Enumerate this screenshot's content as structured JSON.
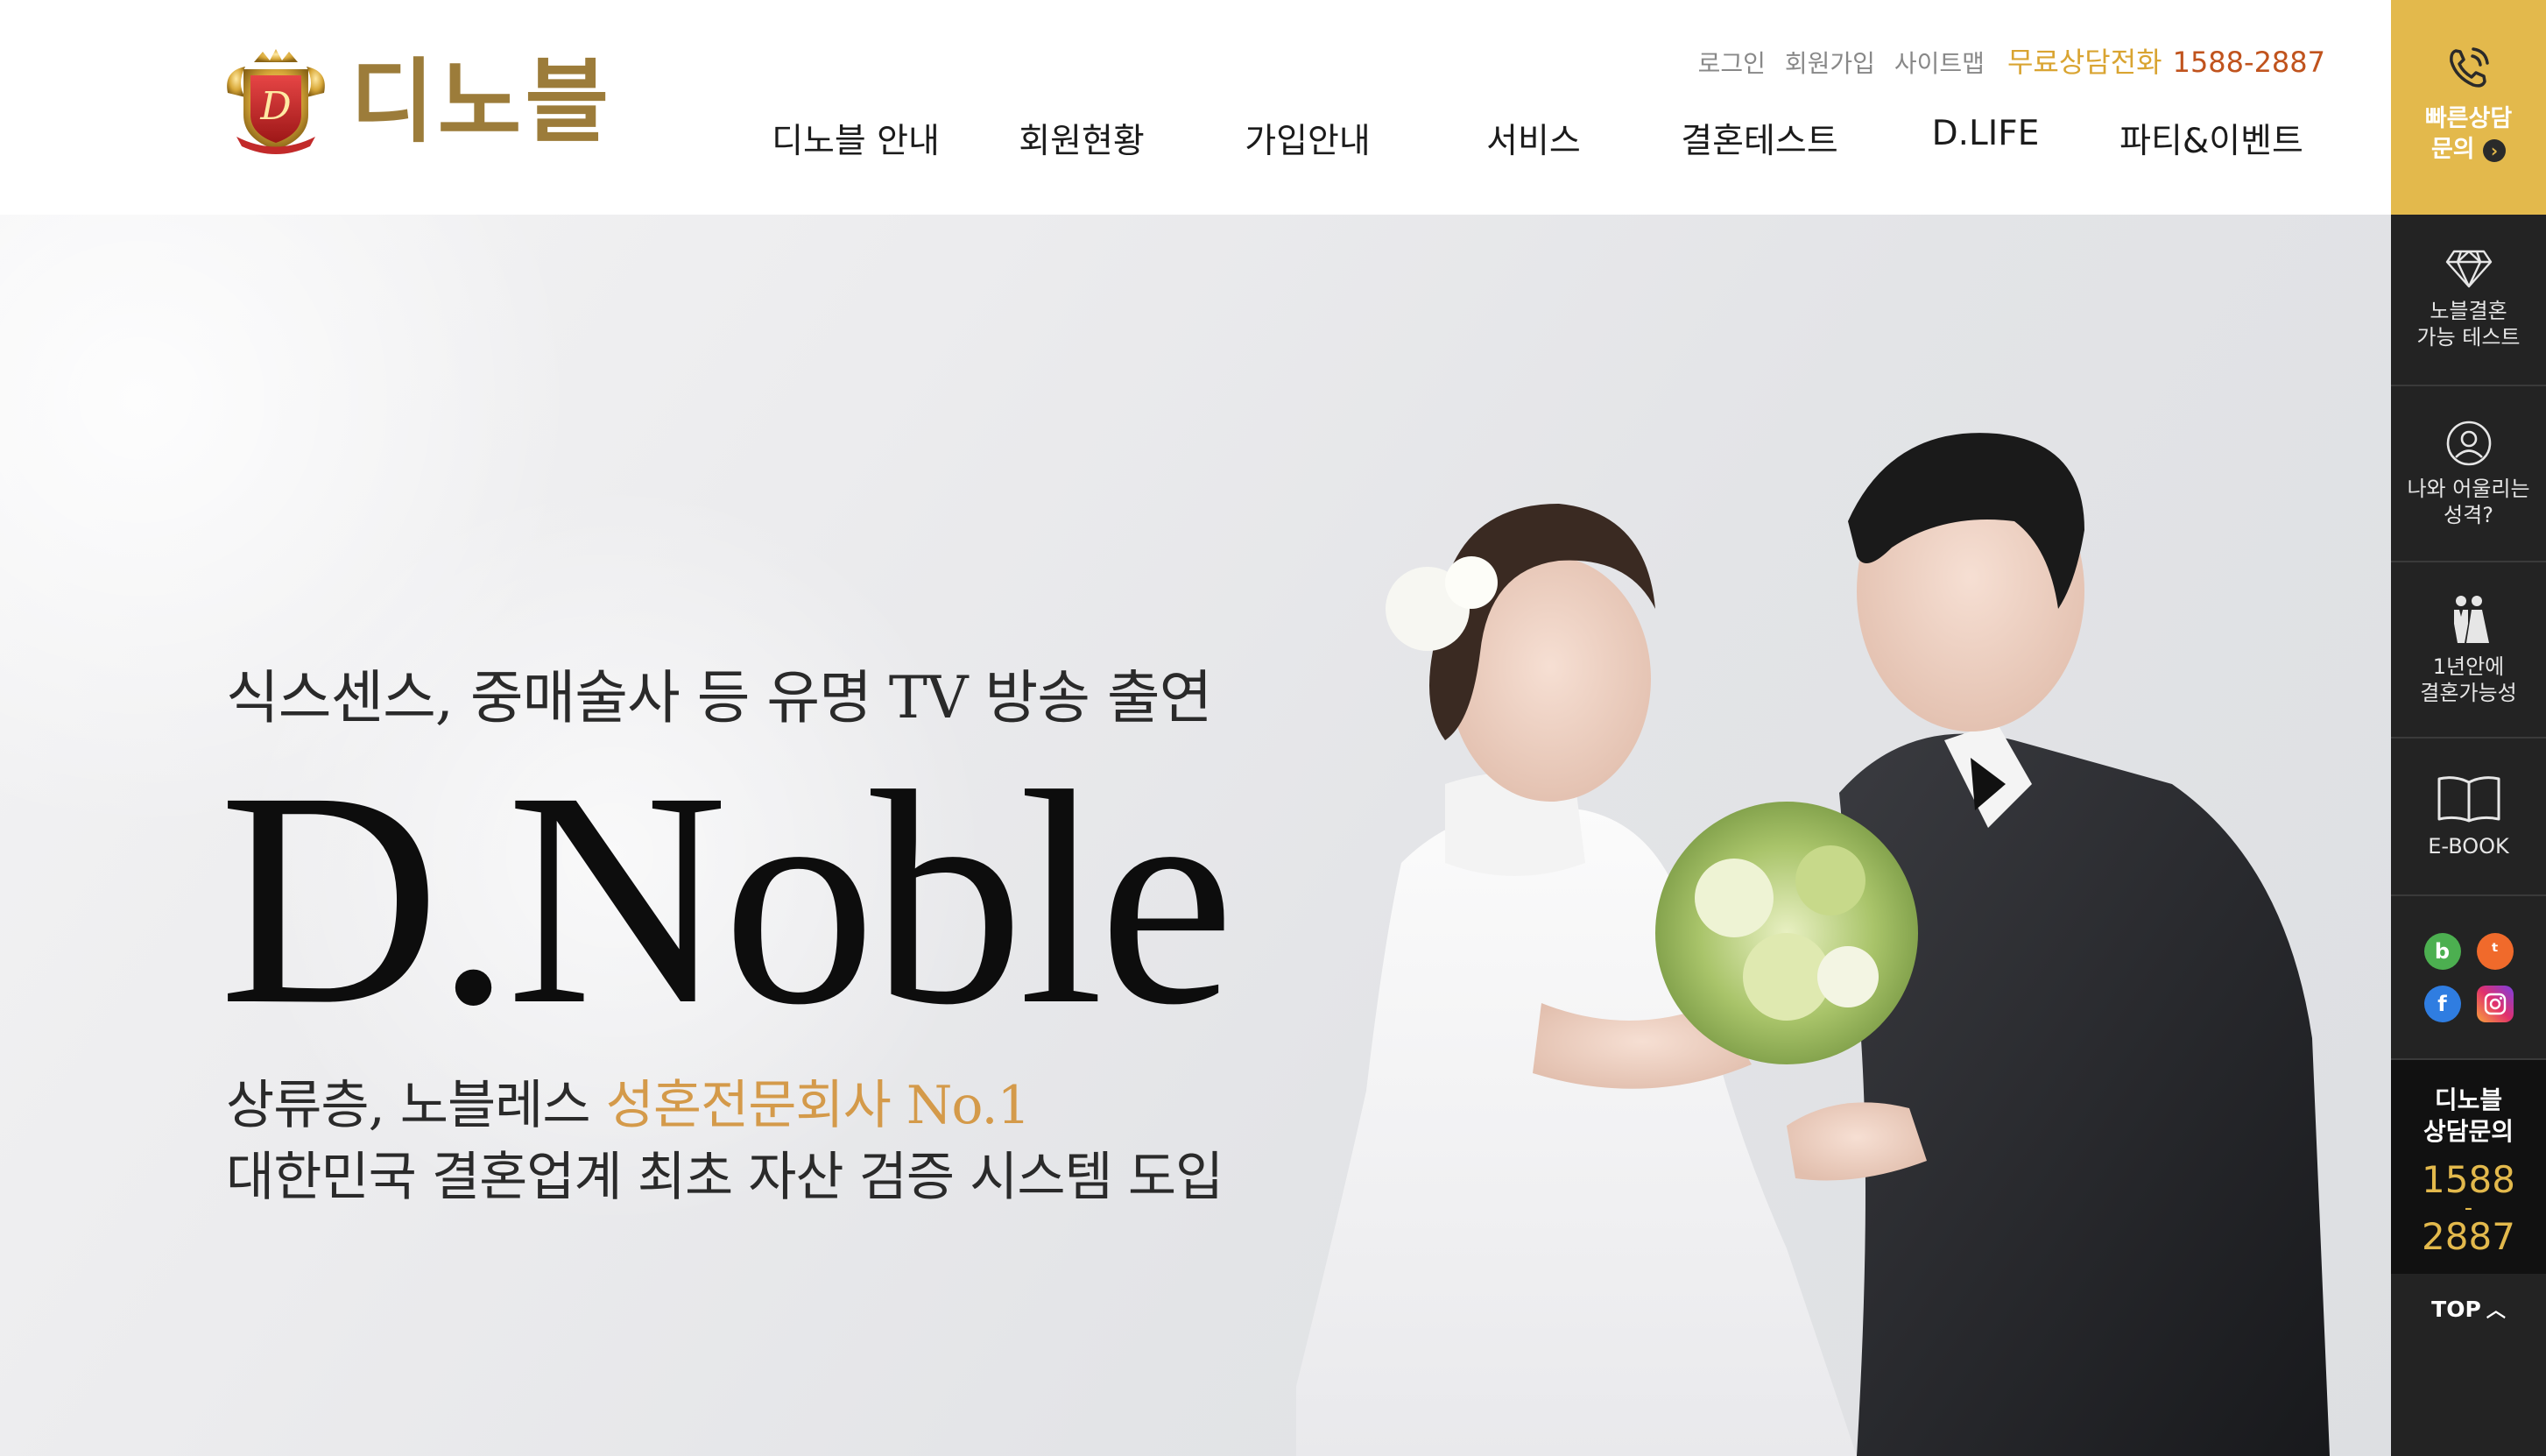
{
  "header": {
    "logo_text": "디노블",
    "util": {
      "login": "로그인",
      "join": "회원가입",
      "sitemap": "사이트맵",
      "phone_label": "무료상담전화",
      "phone_number": "1588-2887"
    },
    "nav": [
      "디노블 안내",
      "회원현황",
      "가입안내",
      "서비스",
      "결혼테스트",
      "D.LIFE",
      "파티&이벤트"
    ]
  },
  "hero": {
    "subtitle": "식스센스, 중매술사 등 유명 TV 방송 출연",
    "title": "D.Noble",
    "line1_prefix": "상류층, 노블레스 ",
    "line1_accent": "성혼전문회사 No.1",
    "line2": "대한민국 결혼업계 최초 자산 검증 시스템 도입"
  },
  "quick": {
    "consult": [
      "빠른상담",
      "문의"
    ],
    "test": [
      "노블결혼",
      "가능 테스트"
    ],
    "personality": [
      "나와 어울리는",
      "성격?"
    ],
    "marriage": [
      "1년안에",
      "결혼가능성"
    ],
    "ebook": [
      "E-BOOK"
    ],
    "call_title": [
      "디노블",
      "상담문의"
    ],
    "call_number": [
      "1588",
      "-",
      "2887"
    ],
    "top": "TOP",
    "sns": [
      "blog-icon",
      "kakao-story-icon",
      "facebook-icon",
      "instagram-icon"
    ]
  },
  "colors": {
    "accent_gold": "#e3b94c",
    "phone_orange": "#c0531d",
    "hero_accent": "#d49a4a",
    "sidebar_dark": "#232323"
  }
}
